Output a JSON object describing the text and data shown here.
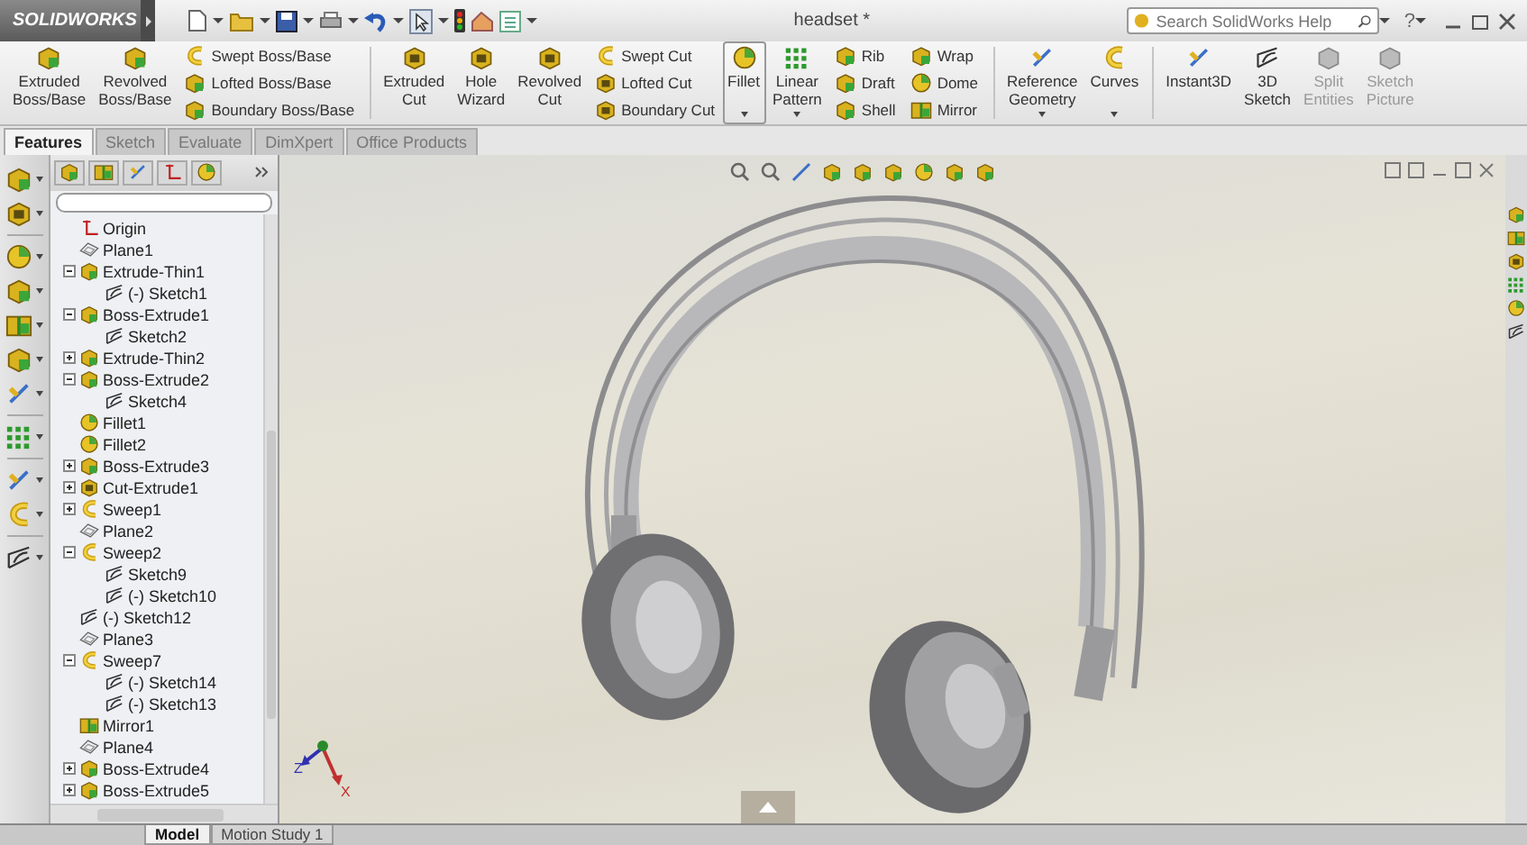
{
  "title_bar": {
    "app_name": "SOLIDWORKS",
    "document_title": "headset *",
    "search": {
      "placeholder": "Search SolidWorks Help"
    },
    "help": "?"
  },
  "ribbon": {
    "groups": [
      {
        "kind": "large",
        "items": [
          {
            "label": "Extruded Boss/Base",
            "disabled": false,
            "dropdown": false,
            "highlighted": false
          },
          {
            "label": "Revolved Boss/Base",
            "disabled": false,
            "dropdown": false,
            "highlighted": false
          }
        ]
      },
      {
        "kind": "stack",
        "items": [
          {
            "label": "Swept Boss/Base",
            "disabled": false
          },
          {
            "label": "Lofted Boss/Base",
            "disabled": false
          },
          {
            "label": "Boundary Boss/Base",
            "disabled": false
          }
        ]
      },
      {
        "kind": "separator"
      },
      {
        "kind": "large",
        "items": [
          {
            "label": "Extruded Cut",
            "disabled": false,
            "dropdown": false,
            "highlighted": false
          },
          {
            "label": "Hole Wizard",
            "disabled": false,
            "dropdown": false,
            "highlighted": false
          },
          {
            "label": "Revolved Cut",
            "disabled": false,
            "dropdown": false,
            "highlighted": false
          }
        ]
      },
      {
        "kind": "stack",
        "items": [
          {
            "label": "Swept Cut",
            "disabled": false
          },
          {
            "label": "Lofted Cut",
            "disabled": false
          },
          {
            "label": "Boundary Cut",
            "disabled": false
          }
        ]
      },
      {
        "kind": "large",
        "items": [
          {
            "label": "Fillet",
            "disabled": false,
            "dropdown": true,
            "highlighted": true
          },
          {
            "label": "Linear Pattern",
            "disabled": false,
            "dropdown": true,
            "highlighted": false
          }
        ]
      },
      {
        "kind": "stack",
        "items": [
          {
            "label": "Rib",
            "disabled": false
          },
          {
            "label": "Draft",
            "disabled": false
          },
          {
            "label": "Shell",
            "disabled": false
          }
        ]
      },
      {
        "kind": "stack",
        "items": [
          {
            "label": "Wrap",
            "disabled": false
          },
          {
            "label": "Dome",
            "disabled": false
          },
          {
            "label": "Mirror",
            "disabled": false
          }
        ]
      },
      {
        "kind": "separator"
      },
      {
        "kind": "large",
        "items": [
          {
            "label": "Reference Geometry",
            "disabled": false,
            "dropdown": true,
            "highlighted": false
          },
          {
            "label": "Curves",
            "disabled": false,
            "dropdown": true,
            "highlighted": false
          }
        ]
      },
      {
        "kind": "separator"
      },
      {
        "kind": "large",
        "items": [
          {
            "label": "Instant3D",
            "disabled": false,
            "dropdown": false,
            "highlighted": false
          },
          {
            "label": "3D Sketch",
            "disabled": false,
            "dropdown": false,
            "highlighted": false
          },
          {
            "label": "Split Entities",
            "disabled": true,
            "dropdown": false,
            "highlighted": false
          },
          {
            "label": "Sketch Picture",
            "disabled": true,
            "dropdown": false,
            "highlighted": false
          }
        ]
      }
    ]
  },
  "command_tabs": [
    {
      "label": "Features",
      "selected": true
    },
    {
      "label": "Sketch",
      "selected": false
    },
    {
      "label": "Evaluate",
      "selected": false
    },
    {
      "label": "DimXpert",
      "selected": false
    },
    {
      "label": "Office Products",
      "selected": false
    }
  ],
  "feature_tree": [
    {
      "label": "Origin",
      "kind": "origin"
    },
    {
      "label": "Plane1",
      "kind": "plane"
    },
    {
      "label": "Extrude-Thin1",
      "kind": "solid",
      "expanded": true,
      "children": [
        {
          "label": "(-) Sketch1",
          "kind": "sketch"
        }
      ]
    },
    {
      "label": "Boss-Extrude1",
      "kind": "solid",
      "expanded": true,
      "children": [
        {
          "label": "Sketch2",
          "kind": "sketch"
        }
      ]
    },
    {
      "label": "Extrude-Thin2",
      "kind": "solid",
      "expanded": false
    },
    {
      "label": "Boss-Extrude2",
      "kind": "solid",
      "expanded": true,
      "children": [
        {
          "label": "Sketch4",
          "kind": "sketch"
        }
      ]
    },
    {
      "label": "Fillet1",
      "kind": "fillet"
    },
    {
      "label": "Fillet2",
      "kind": "fillet"
    },
    {
      "label": "Boss-Extrude3",
      "kind": "solid",
      "expanded": false
    },
    {
      "label": "Cut-Extrude1",
      "kind": "cut",
      "expanded": false
    },
    {
      "label": "Sweep1",
      "kind": "sweep",
      "expanded": false
    },
    {
      "label": "Plane2",
      "kind": "plane"
    },
    {
      "label": "Sweep2",
      "kind": "sweep",
      "expanded": true,
      "children": [
        {
          "label": "Sketch9",
          "kind": "sketch"
        },
        {
          "label": "(-) Sketch10",
          "kind": "sketch"
        }
      ]
    },
    {
      "label": "(-) Sketch12",
      "kind": "sketch"
    },
    {
      "label": "Plane3",
      "kind": "plane"
    },
    {
      "label": "Sweep7",
      "kind": "sweep",
      "expanded": true,
      "children": [
        {
          "label": "(-) Sketch14",
          "kind": "sketch"
        },
        {
          "label": "(-) Sketch13",
          "kind": "sketch"
        }
      ]
    },
    {
      "label": "Mirror1",
      "kind": "mirror"
    },
    {
      "label": "Plane4",
      "kind": "plane"
    },
    {
      "label": "Boss-Extrude4",
      "kind": "solid",
      "expanded": false
    },
    {
      "label": "Boss-Extrude5",
      "kind": "solid",
      "expanded": false
    }
  ],
  "triad": {
    "z_label": "Z",
    "x_label": "X"
  },
  "bottom_tabs": [
    {
      "label": "Model",
      "selected": true
    },
    {
      "label": "Motion Study 1",
      "selected": false
    }
  ]
}
